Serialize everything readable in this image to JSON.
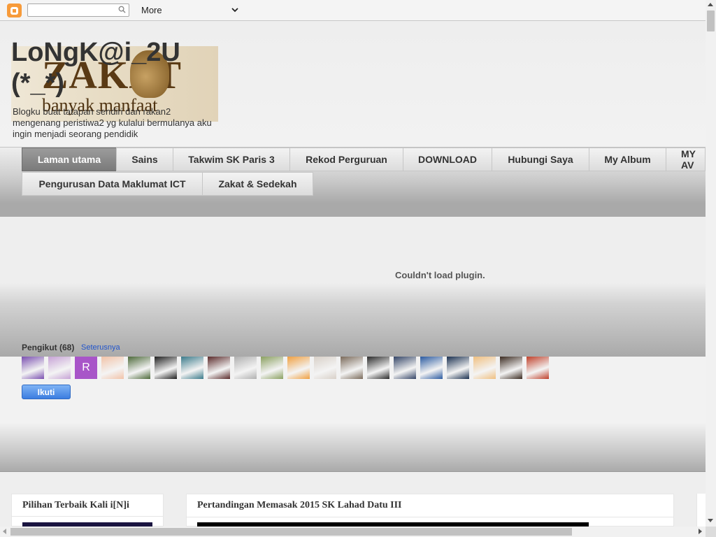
{
  "navbar": {
    "search_placeholder": "",
    "more_label": "More"
  },
  "header": {
    "title": "LoNgK@i_2U (*_*)",
    "description": "Blogku buat tatapan sendiri dan rakan2 mengenang peristiwa2 yg kulalui bermulanya aku ingin menjadi seorang pendidik",
    "image_text": "ZAKAT",
    "image_tagline": "banyak manfaat"
  },
  "tabs": [
    {
      "label": "Laman utama",
      "active": true
    },
    {
      "label": "Sains"
    },
    {
      "label": "Takwim SK Paris 3"
    },
    {
      "label": "Rekod Perguruan"
    },
    {
      "label": "DOWNLOAD"
    },
    {
      "label": "Hubungi Saya"
    },
    {
      "label": "My Album"
    },
    {
      "label": "MY AV"
    },
    {
      "label": "Pengurusan Data Maklumat ICT"
    },
    {
      "label": "Zakat & Sedekah"
    }
  ],
  "plugin": {
    "message": "Couldn't load plugin."
  },
  "followers": {
    "title": "Pengikut (68)",
    "more_link": "Seterusnya",
    "follow_button": "Ikuti",
    "avatars": [
      {
        "kind": "photo",
        "color": "#7a4fb0"
      },
      {
        "kind": "photo",
        "color": "#c7a3d6"
      },
      {
        "kind": "letter",
        "letter": "R",
        "color": "#a855c8"
      },
      {
        "kind": "photo",
        "color": "#f2c3a8"
      },
      {
        "kind": "photo",
        "color": "#4d6a3a"
      },
      {
        "kind": "photo",
        "color": "#1f1f1f"
      },
      {
        "kind": "photo",
        "color": "#3a7a8a"
      },
      {
        "kind": "photo",
        "color": "#5a2a2a"
      },
      {
        "kind": "photo",
        "color": "#b0b0b0"
      },
      {
        "kind": "photo",
        "color": "#8aa060"
      },
      {
        "kind": "photo",
        "color": "#f0a040"
      },
      {
        "kind": "photo",
        "color": "#d8d0c8"
      },
      {
        "kind": "photo",
        "color": "#7a6a5a"
      },
      {
        "kind": "photo",
        "color": "#2a2a2a"
      },
      {
        "kind": "photo",
        "color": "#334466"
      },
      {
        "kind": "photo",
        "color": "#2a5aa0"
      },
      {
        "kind": "photo",
        "color": "#1a3050"
      },
      {
        "kind": "photo",
        "color": "#f0c080"
      },
      {
        "kind": "photo",
        "color": "#3a2a20"
      },
      {
        "kind": "photo",
        "color": "#c0402a"
      }
    ]
  },
  "sidebar": {
    "title": "Pilihan Terbaik Kali i[N]i"
  },
  "main": {
    "post_title": "Pertandingan Memasak 2015 SK Lahad Datu III"
  }
}
